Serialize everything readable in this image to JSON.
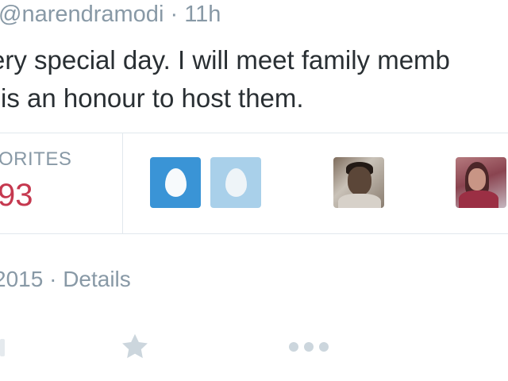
{
  "tweet": {
    "handle": "@narendramodi",
    "separator": "·",
    "time": "11h",
    "text_line1": "ery special day. I will meet family memb",
    "text_line2": "is an honour to host them."
  },
  "stats": {
    "favorites_label": "ORITES",
    "favorites_count": "93"
  },
  "avatars": [
    {
      "icon": "default-egg-avatar",
      "shade": "#3a94d6"
    },
    {
      "icon": "default-egg-avatar",
      "shade": "#a9d0ea"
    },
    {
      "icon": "user-photo-avatar"
    },
    {
      "icon": "user-photo-avatar"
    }
  ],
  "meta": {
    "date": "2015",
    "separator": "·",
    "details_link": "Details"
  },
  "actions": {
    "favorite_icon": "star-icon",
    "more_icon": "more-dots-icon"
  },
  "colors": {
    "muted": "#8899a6",
    "text": "#292f33",
    "count": "#c5384f",
    "border": "#e1e8ed",
    "icon": "#ccd6dd"
  }
}
